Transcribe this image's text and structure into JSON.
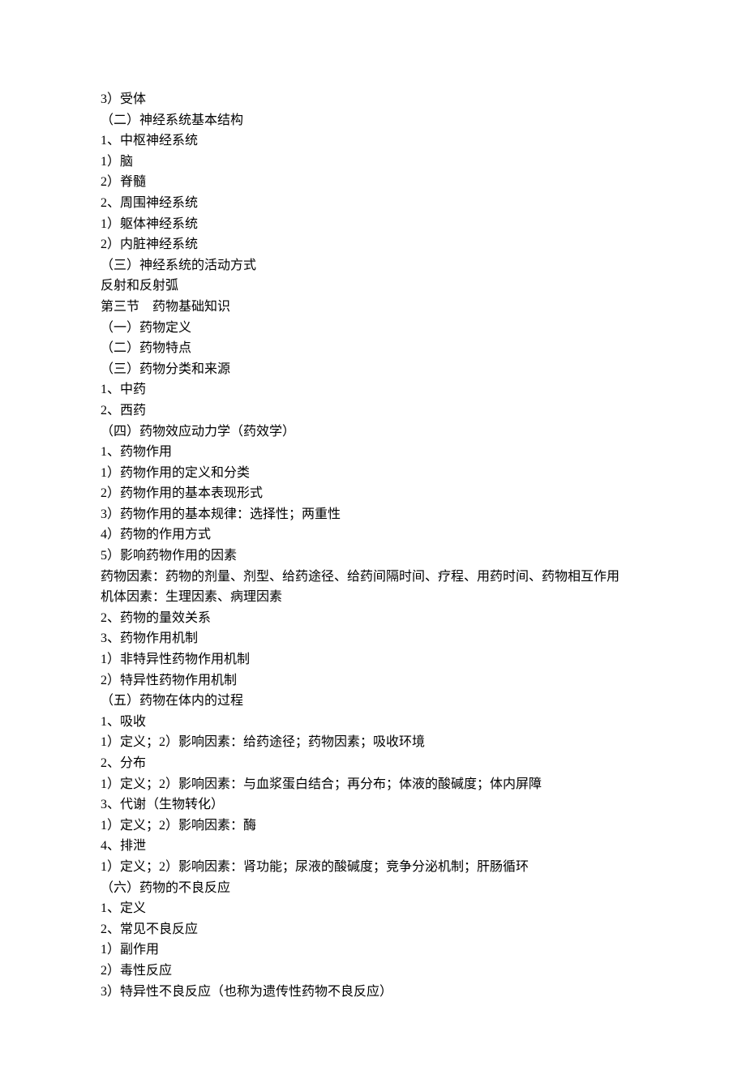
{
  "lines": [
    "3）受体",
    "（二）神经系统基本结构",
    "1、中枢神经系统",
    "1）脑",
    "2）脊髓",
    "2、周围神经系统",
    "1）躯体神经系统",
    "2）内脏神经系统",
    "（三）神经系统的活动方式",
    "反射和反射弧",
    "第三节　药物基础知识",
    "（一）药物定义",
    "（二）药物特点",
    "（三）药物分类和来源",
    "1、中药",
    "2、西药",
    "（四）药物效应动力学（药效学）",
    "1、药物作用",
    "1）药物作用的定义和分类",
    "2）药物作用的基本表现形式",
    "3）药物作用的基本规律：选择性；两重性",
    "4）药物的作用方式",
    "5）影响药物作用的因素",
    "药物因素：药物的剂量、剂型、给药途径、给药间隔时间、疗程、用药时间、药物相互作用",
    "机体因素：生理因素、病理因素",
    "2、药物的量效关系",
    "3、药物作用机制",
    "1）非特异性药物作用机制",
    "2）特异性药物作用机制",
    "（五）药物在体内的过程",
    "1、吸收",
    "1）定义；2）影响因素：给药途径；药物因素；吸收环境",
    "2、分布",
    "1）定义；2）影响因素：与血浆蛋白结合；再分布；体液的酸碱度；体内屏障",
    "3、代谢（生物转化）",
    "1）定义；2）影响因素：酶",
    "4、排泄",
    "1）定义；2）影响因素：肾功能；尿液的酸碱度；竞争分泌机制；肝肠循环",
    "（六）药物的不良反应",
    "1、定义",
    "2、常见不良反应",
    "1）副作用",
    "2）毒性反应",
    "3）特异性不良反应（也称为遗传性药物不良反应）"
  ]
}
